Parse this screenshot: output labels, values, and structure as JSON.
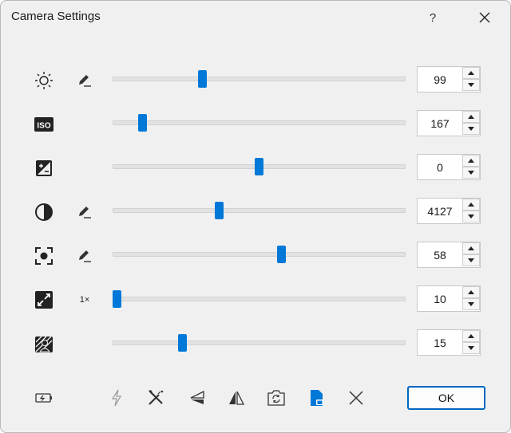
{
  "window": {
    "title": "Camera Settings",
    "help_label": "?",
    "close_icon": "close-icon"
  },
  "settings": [
    {
      "name": "brightness",
      "icon": "brightness-icon",
      "aux": "edit-icon",
      "aux_text": "",
      "value": "99",
      "level": 0.3
    },
    {
      "name": "iso",
      "icon": "iso-icon",
      "aux": "",
      "aux_text": "",
      "value": "167",
      "level": 0.09
    },
    {
      "name": "exposure",
      "icon": "exposure-compensation-icon",
      "aux": "",
      "aux_text": "",
      "value": "0",
      "level": 0.5
    },
    {
      "name": "contrast",
      "icon": "contrast-icon",
      "aux": "edit-icon",
      "aux_text": "",
      "value": "4127",
      "level": 0.36
    },
    {
      "name": "focus",
      "icon": "focus-icon",
      "aux": "edit-icon",
      "aux_text": "",
      "value": "58",
      "level": 0.58
    },
    {
      "name": "zoom",
      "icon": "zoom-icon",
      "aux": "",
      "aux_text": "1×",
      "value": "10",
      "level": 0.0
    },
    {
      "name": "backlight",
      "icon": "backlight-icon",
      "aux": "",
      "aux_text": "",
      "value": "15",
      "level": 0.23
    }
  ],
  "toolbar": {
    "icons": [
      "battery-icon",
      "flash-icon",
      "tools-icon",
      "flip-vertical-icon",
      "mirror-icon",
      "switch-camera-icon",
      "lock-file-icon",
      "reset-icon"
    ]
  },
  "buttons": {
    "ok_label": "OK"
  },
  "colors": {
    "accent": "#0078d7",
    "background": "#f0f0f0"
  }
}
